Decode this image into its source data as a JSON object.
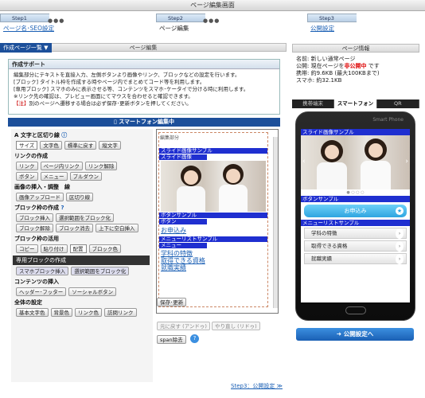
{
  "window": {
    "title": "ページ編集画面"
  },
  "steps": [
    {
      "num": "Step1",
      "label": "ページ名･SEO設定"
    },
    {
      "num": "Step2",
      "label": "ページ編集"
    },
    {
      "num": "Step3",
      "label": "公開設定"
    }
  ],
  "left": {
    "panel_title": "ページ編集",
    "tab_list": "作成ページ一覧",
    "help": {
      "title": "作成サポート",
      "lines": [
        "編集部分にテキストを直接入力、左側ボタンより画像やリンク、ブロックなどの設定を行います。",
        "[ブロック] タイトル枠を作成する時やページ内でまとめてコード等を利用します。",
        "[専用ブロック] スマホのみに表示させる等、コンテンツをスマホ･ケータイで分ける時に利用します。",
        "※リンク先の確認は、プレビュー画面にてマウスを合わせると確認できます。"
      ],
      "warn_tag": "【注】",
      "warn_text": "別のページへ遷移する場合は必ず保存･更新ボタンを押してください。"
    },
    "sp_bar": "スマートフォン編集中",
    "sections": {
      "text": {
        "title": "文字と区切り線",
        "size": "サイズ",
        "color": "文字色",
        "bg": "標準に戻す",
        "wide": "縦文字"
      },
      "link": {
        "title": "リンクの作成",
        "buttons": [
          "リンク",
          "ページ内リンク",
          "リンク解除",
          "ボタン",
          "メニュー",
          "プルダウン"
        ]
      },
      "image": {
        "title": "画像の挿入・調整",
        "line_title": "線",
        "upload": "画像アップロード",
        "sep": "区切り線"
      },
      "block": {
        "title": "ブロック枠の作成",
        "buttons": [
          "ブロック挿入",
          "選択範囲をブロック化",
          "ブロック解除",
          "ブロック消去",
          "上下に空白挿入"
        ]
      },
      "block_use": {
        "title": "ブロック枠の活用",
        "buttons": [
          "コピー",
          "貼り付け",
          "配置",
          "ブロック色"
        ]
      },
      "special": {
        "title": "専用ブロックの作成",
        "insert": "スマホブロック挿入",
        "select": "選択範囲をブロック化"
      },
      "contents": {
        "title": "コンテンツの挿入",
        "buttons": [
          "ヘッダー･フッター",
          "ソーシャルボタン"
        ]
      },
      "global": {
        "title": "全体の設定",
        "buttons": [
          "基本文字色",
          "背景色",
          "リンク色",
          "訪問リンク"
        ]
      }
    },
    "preview": {
      "label": "編集部分",
      "slide": "スライド画像サンプル",
      "slide_sub": "スライド画像",
      "button_sample": "ボタンサンプル",
      "button_sub": "ボタン",
      "apply": "お申込み",
      "menu_sample": "メニューリストサンプル",
      "menu_sub": "メニュー",
      "links": [
        "学科の特徴",
        "取得できる資格",
        "就職実績"
      ]
    },
    "save": "保存･更新",
    "undo": "元に戻す (アンドゥ)",
    "redo": "やり直し (リドゥ)",
    "span": "span除去",
    "next": "Step3：公開設定 ≫"
  },
  "right": {
    "panel_title": "ページ情報",
    "info": {
      "name_label": "名前:",
      "name_value": "新しい通常ページ",
      "pub_label": "公開:",
      "pub_prefix": "現在ページを",
      "pub_status": "非公開中",
      "pub_suffix": "です",
      "mobile_label": "携帯:",
      "mobile_value": "約9.6KB (最大100KBまで)",
      "sp_label": "スマホ:",
      "sp_value": "約32.1KB"
    },
    "tabs": [
      "携帯端末",
      "スマートフォン",
      "QR"
    ],
    "phone": {
      "brand": "Smart Phone",
      "slide": "スライド画像サンプル",
      "button_sample": "ボタンサンプル",
      "apply": "お申込み",
      "menu_sample": "メニューリストサンプル",
      "menu_items": [
        "学科の特徴",
        "取得できる資格",
        "就職実績"
      ]
    },
    "publish": "公開設定へ"
  },
  "colors": {
    "accent": "#1c4f9a",
    "bluebar": "#1f2fd0",
    "status": "#d00000"
  }
}
